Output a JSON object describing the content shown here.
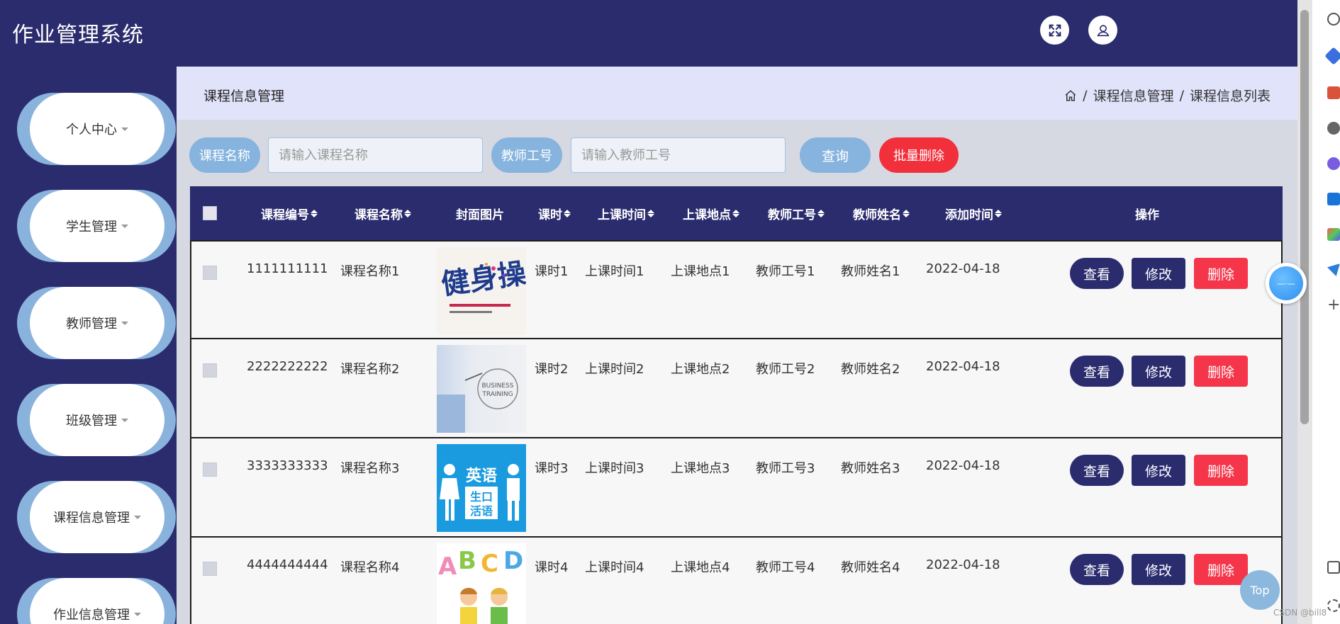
{
  "app": {
    "title": "作业管理系统"
  },
  "header": {
    "fullscreen_icon": "fullscreen-icon",
    "user_icon": "user-icon"
  },
  "sidebar": {
    "items": [
      {
        "label": "个人中心"
      },
      {
        "label": "学生管理"
      },
      {
        "label": "教师管理"
      },
      {
        "label": "班级管理"
      },
      {
        "label": "课程信息管理"
      },
      {
        "label": "作业信息管理"
      }
    ]
  },
  "page": {
    "title": "课程信息管理",
    "breadcrumb": {
      "home_icon": "home-icon",
      "separator": "/",
      "items": [
        "课程信息管理",
        "课程信息列表"
      ]
    }
  },
  "search": {
    "course_name_label": "课程名称",
    "course_name_placeholder": "请输入课程名称",
    "course_name_value": "",
    "teacher_id_label": "教师工号",
    "teacher_id_placeholder": "请输入教师工号",
    "teacher_id_value": "",
    "query_label": "查询",
    "batch_delete_label": "批量删除"
  },
  "table": {
    "headers": {
      "course_id": "课程编号",
      "course_name": "课程名称",
      "cover": "封面图片",
      "hours": "课时",
      "class_time": "上课时间",
      "location": "上课地点",
      "teacher_id": "教师工号",
      "teacher_name": "教师姓名",
      "added": "添加时间",
      "actions": "操作"
    },
    "rows": [
      {
        "course_id": "1111111111",
        "course_name": "课程名称1",
        "cover_alt": "健身操",
        "hours": "课时1",
        "class_time": "上课时间1",
        "location": "上课地点1",
        "teacher_id": "教师工号1",
        "teacher_name": "教师姓名1",
        "added": "2022-04-18"
      },
      {
        "course_id": "2222222222",
        "course_name": "课程名称2",
        "cover_alt": "BUSINESS TRAINING",
        "hours": "课时2",
        "class_time": "上课时间2",
        "location": "上课地点2",
        "teacher_id": "教师工号2",
        "teacher_name": "教师姓名2",
        "added": "2022-04-18"
      },
      {
        "course_id": "3333333333",
        "course_name": "课程名称3",
        "cover_alt": "英语生口活语",
        "hours": "课时3",
        "class_time": "上课时间3",
        "location": "上课地点3",
        "teacher_id": "教师工号3",
        "teacher_name": "教师姓名3",
        "added": "2022-04-18"
      },
      {
        "course_id": "4444444444",
        "course_name": "课程名称4",
        "cover_alt": "ABCD",
        "hours": "课时4",
        "class_time": "上课时间4",
        "location": "上课地点4",
        "teacher_id": "教师工号4",
        "teacher_name": "教师姓名4",
        "added": "2022-04-18"
      }
    ],
    "actions": {
      "view": "查看",
      "edit": "修改",
      "delete": "删除"
    }
  },
  "floating": {
    "top_label": "Top"
  },
  "watermark": "CSDN @bill8"
}
